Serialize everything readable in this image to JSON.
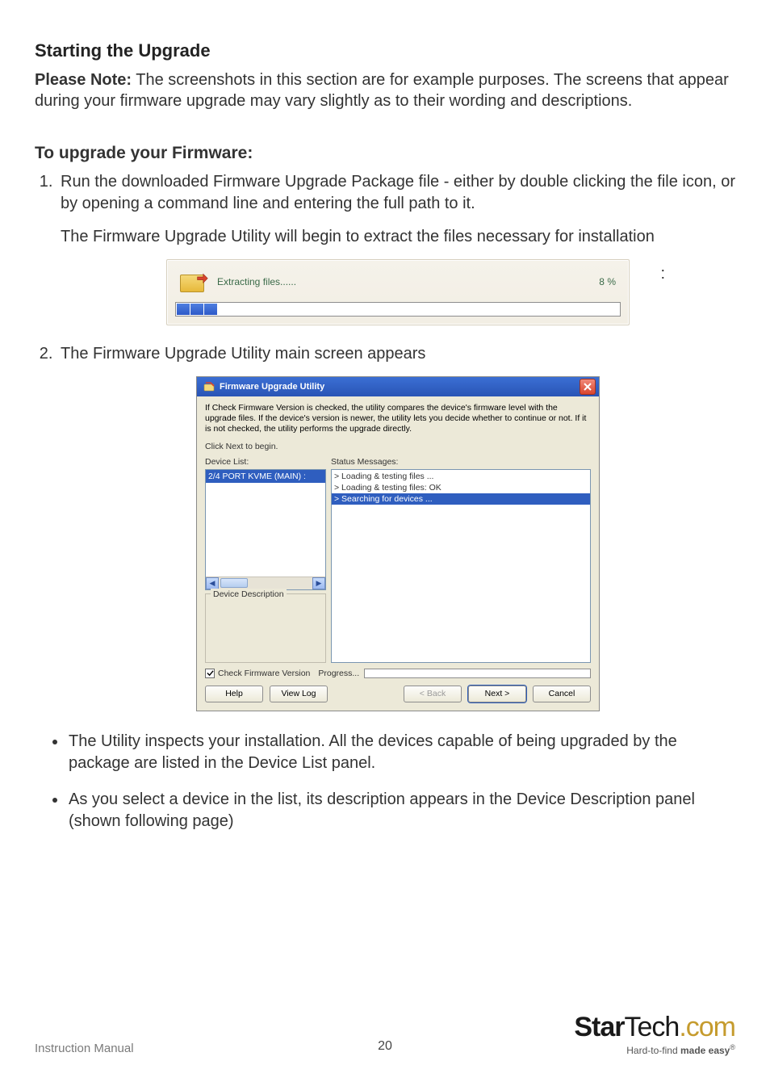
{
  "section_heading": "Starting the Upgrade",
  "please_note_label": "Please Note:",
  "please_note_text": " The screenshots in this section are for example purposes. The screens that appear during your firmware upgrade may vary slightly as to their wording and descriptions.",
  "subheading": "To upgrade your Firmware:",
  "steps": {
    "s1_a": "Run the downloaded Firmware Upgrade Package file - either by double clicking the file icon, or by opening a command line and entering the full path to it.",
    "s1_b": "The Firmware Upgrade Utility will begin to extract the files necessary for installation",
    "s2": "The Firmware Upgrade Utility main screen appears"
  },
  "colon": ":",
  "bullets": {
    "b1": "The Utility inspects your installation. All the devices capable of being upgraded by the package are listed in the Device List panel.",
    "b2": "As you select a device in the list, its description appears in the Device Description panel (shown following page)"
  },
  "extractor": {
    "label": "Extracting files......",
    "percent": "8",
    "percent_suffix": " %",
    "segments": 3
  },
  "utility": {
    "title": "Firmware Upgrade Utility",
    "description": "If Check Firmware Version is checked, the utility compares the device's firmware level with the upgrade files. If the device's version is newer, the utility lets you decide whether to continue or not. If it is not checked, the utility performs the upgrade directly.",
    "instruction": "Click Next to begin.",
    "device_list_label": "Device List:",
    "status_label": "Status Messages:",
    "device_list_item": "2/4 PORT KVME (MAIN) :",
    "status_messages": {
      "m1": "> Loading & testing files ...",
      "m2": "> Loading & testing files: OK",
      "m3": "> Searching for devices ..."
    },
    "device_description_label": "Device Description",
    "check_label": "Check Firmware Version",
    "progress_label": "Progress...",
    "buttons": {
      "help": "Help",
      "view_log": "View Log",
      "back": "< Back",
      "next": "Next >",
      "cancel": "Cancel"
    }
  },
  "footer": {
    "instruction_manual": "Instruction Manual",
    "page_number": "20",
    "brand_first": "Star",
    "brand_second": "Tech",
    "brand_dot_com": ".com",
    "tagline_a": "Hard-to-find ",
    "tagline_b": "made easy",
    "reg": "®"
  }
}
